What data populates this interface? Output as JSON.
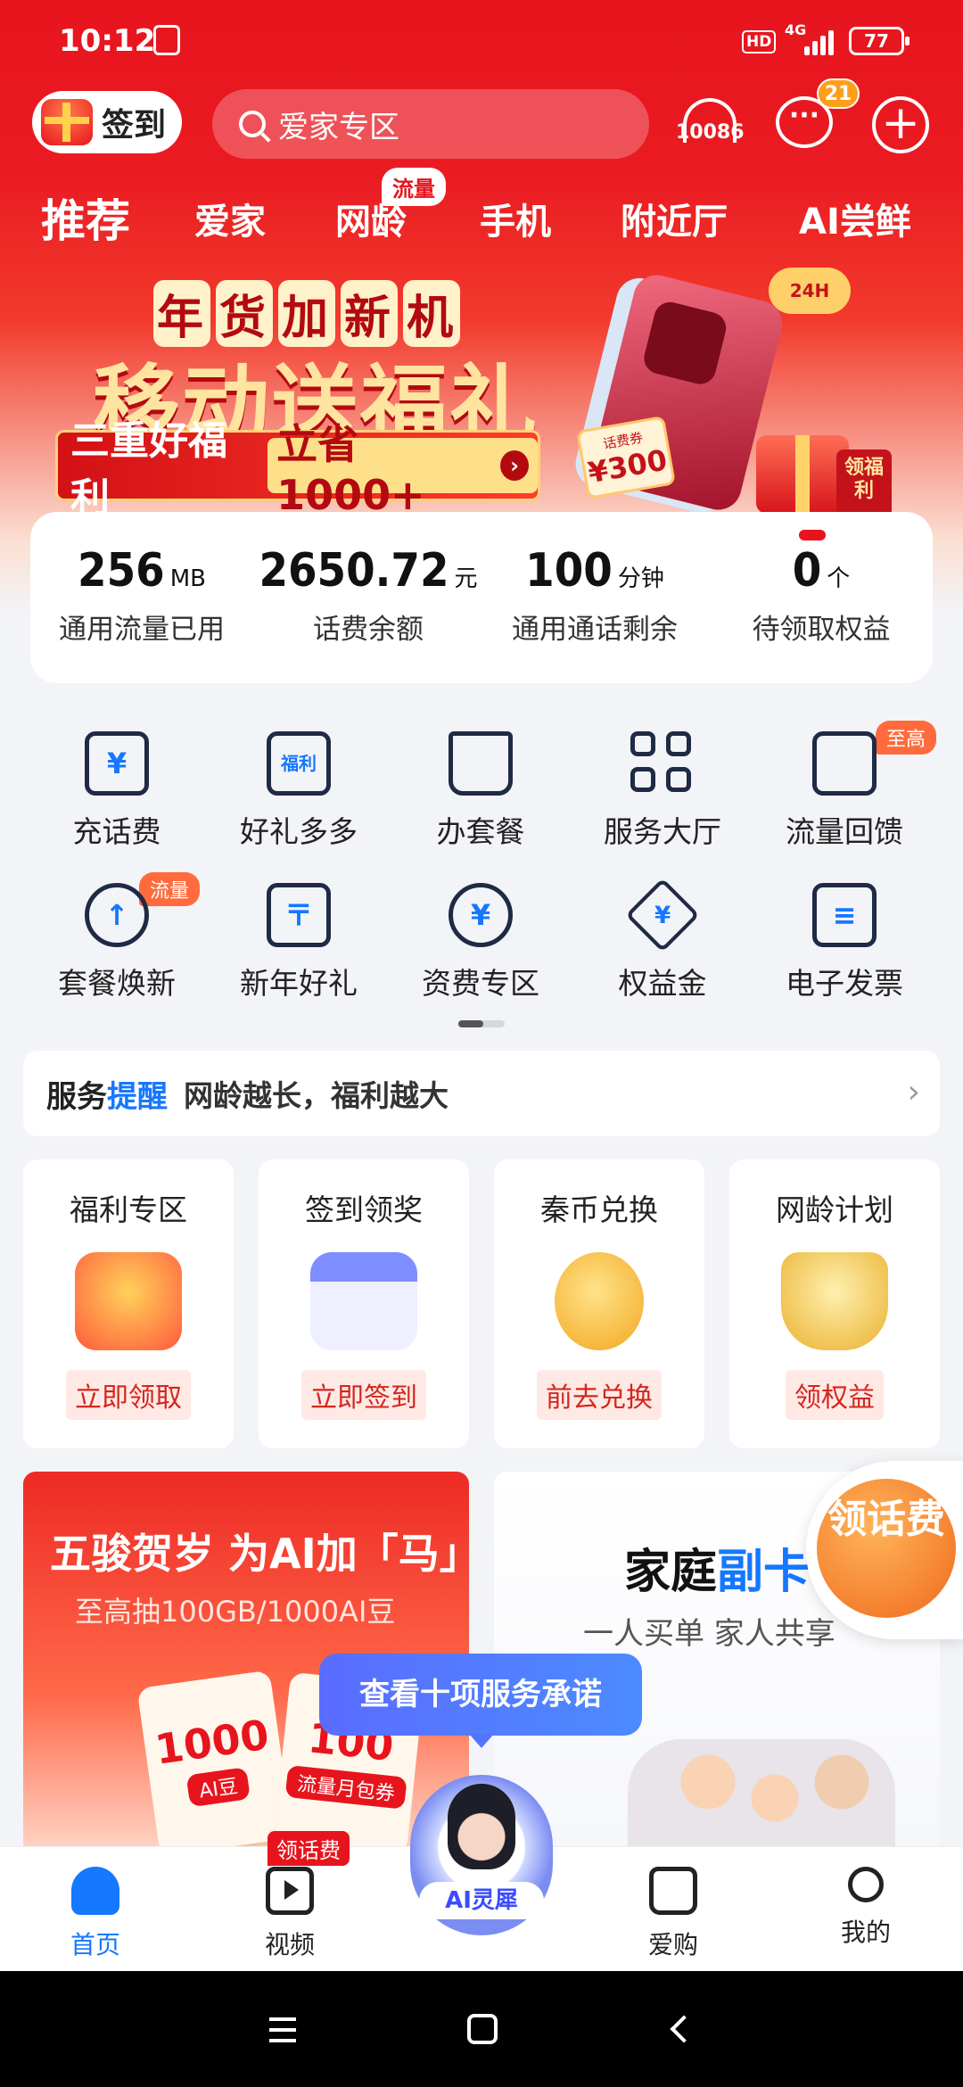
{
  "status_bar": {
    "time": "10:12",
    "hd": "HD",
    "network": "4G",
    "battery": "77"
  },
  "header": {
    "checkin_label": "签到",
    "search_placeholder": "爱家专区",
    "hotline": "10086",
    "message_count": "21"
  },
  "tabs": [
    {
      "label": "推荐"
    },
    {
      "label": "爱家"
    },
    {
      "label": "网龄",
      "badge": "流量"
    },
    {
      "label": "手机"
    },
    {
      "label": "附近厅"
    },
    {
      "label": "AI尝鲜"
    }
  ],
  "banner": {
    "tag": [
      "年",
      "货",
      "加",
      "新",
      "机"
    ],
    "title": "移动送福礼",
    "cta_left": "三重好福利",
    "cta_right": "立省1000+",
    "coupon_label": "话费券",
    "coupon_value": "¥300",
    "hour_badge": "24H",
    "seal_text": "领福利"
  },
  "balance": [
    {
      "value": "256",
      "unit": "MB",
      "label": "通用流量已用"
    },
    {
      "value": "2650.72",
      "unit": "元",
      "label": "话费余额"
    },
    {
      "value": "100",
      "unit": "分钟",
      "label": "通用通话剩余"
    },
    {
      "value": "0",
      "unit": "个",
      "label": "待领取权益"
    }
  ],
  "grid": [
    {
      "label": "充话费",
      "glyph": "¥",
      "icon": "phone-recharge-icon"
    },
    {
      "label": "好礼多多",
      "glyph": "福利",
      "icon": "gift-box-icon"
    },
    {
      "label": "办套餐",
      "glyph": "",
      "icon": "shopping-bag-icon"
    },
    {
      "label": "服务大厅",
      "glyph": "",
      "icon": "grid-apps-icon"
    },
    {
      "label": "流量回馈",
      "glyph": "",
      "icon": "gift-icon",
      "badge": "至高"
    },
    {
      "label": "套餐焕新",
      "glyph": "↑",
      "icon": "upgrade-bag-icon",
      "badge": "流量"
    },
    {
      "label": "新年好礼",
      "glyph": "〒",
      "icon": "new-year-gift-icon"
    },
    {
      "label": "资费专区",
      "glyph": "¥",
      "icon": "tariff-search-icon"
    },
    {
      "label": "权益金",
      "glyph": "¥",
      "icon": "diamond-icon"
    },
    {
      "label": "电子发票",
      "glyph": "≡",
      "icon": "invoice-icon"
    }
  ],
  "reminder": {
    "title_a": "服务",
    "title_b": "提醒",
    "text": "网龄越长，福利越大"
  },
  "cards": [
    {
      "title": "福利专区",
      "button": "立即领取",
      "color": "#ff5a3c",
      "icon": "gift-bag-illustration"
    },
    {
      "title": "签到领奖",
      "button": "立即签到",
      "color": "#8c9bff",
      "icon": "calendar-illustration"
    },
    {
      "title": "秦币兑换",
      "button": "前去兑换",
      "color": "#ffb93b",
      "icon": "coin-illustration"
    },
    {
      "title": "网龄计划",
      "button": "领权益",
      "color": "#ffc94a",
      "icon": "trophy-illustration"
    }
  ],
  "promo_left": {
    "title": "五骏贺岁 为AI加「马」",
    "subtitle": "至高抽100GB/1000AI豆",
    "ticket_a_value": "1000",
    "ticket_a_label": "AI豆",
    "ticket_b_value": "100",
    "ticket_b_label": "流量月包券"
  },
  "promo_right": {
    "title_a": "家庭",
    "title_b": "副卡",
    "subtitle": "一人买单 家人共享"
  },
  "float_fee": "领话费",
  "promise_bubble": "查看十项服务承诺",
  "tabbar": {
    "home": "首页",
    "video": "视频",
    "video_badge": "领话费",
    "ai": "AI灵犀",
    "shop": "爱购",
    "me": "我的"
  },
  "colors": {
    "brand_red": "#e8141d",
    "accent_blue": "#1677ff"
  }
}
